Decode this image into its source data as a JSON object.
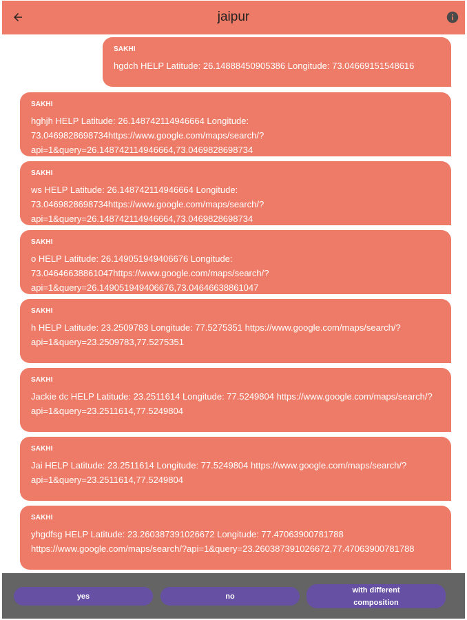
{
  "header": {
    "title": "jaipur",
    "back_icon": "arrow-left-icon",
    "info_icon": "info-icon"
  },
  "colors": {
    "accent": "#ee7b67",
    "button": "#6650a4",
    "footer": "#646464"
  },
  "messages": [
    {
      "sender": "SAKHI",
      "text": "hgdch HELP Latitude: 26.1488845090538​6 Longitude: 73.04669151548616"
    },
    {
      "sender": "SAKHI",
      "text": "hghjh HELP Latitude: 26.148742114946664 Longitude: 73.0469828698734https://www.google.com/maps/search/?api=1&query=26.148742114946664,73.0469828698734"
    },
    {
      "sender": "SAKHI",
      "text": "ws HELP Latitude: 26.148742114946664 Longitude: 73.0469828698734https://www.google.com/maps/search/?api=1&query=26.148742114946664,73.0469828698734"
    },
    {
      "sender": "SAKHI",
      "text": "o HELP Latitude: 26.149051949406676 Longitude: 73.04646638861047https://www.google.com/maps/search/?api=1&query=26.149051949406676,73.04646638861047"
    },
    {
      "sender": "SAKHI",
      "text": "h HELP Latitude: 23.2509783 Longitude: 77.5275351 https://www.google.com/maps/search/?api=1&query=23.2509783,77.5275351"
    },
    {
      "sender": "SAKHI",
      "text": "Jackie dc HELP Latitude: 23.2511614 Longitude: 77.5249804 https://www.google.com/maps/search/?api=1&query=23.2511614,77.5249804"
    },
    {
      "sender": "SAKHI",
      "text": "Jai HELP Latitude: 23.2511614 Longitude: 77.5249804 https://www.google.com/maps/search/?api=1&query=23.2511614,77.5249804"
    },
    {
      "sender": "SAKHI",
      "text": "yhgdfsg HELP Latitude: 23.260387391026672 Longitude: 77.47063900781788 https://www.google.com/maps/search/?api=1&query=23.260387391026672,77.47063900781788"
    }
  ],
  "footer": {
    "yes_label": "yes",
    "no_label": "no",
    "different_label": "with different composition"
  }
}
